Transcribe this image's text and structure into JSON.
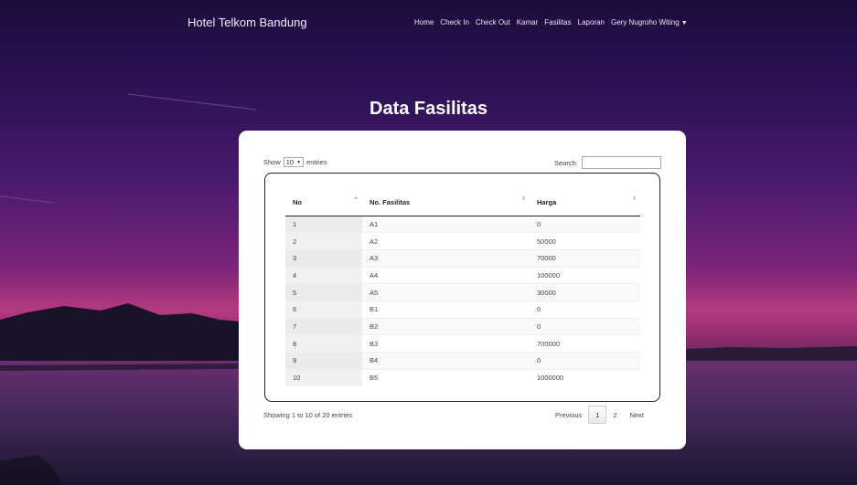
{
  "nav": {
    "brand": "Hotel Telkom Bandung",
    "links": [
      "Home",
      "Check In",
      "Check Out",
      "Kamar",
      "Fasilitas",
      "Laporan"
    ],
    "user": "Gery Nugroho Witing"
  },
  "page_title": "Data Fasilitas",
  "table_controls": {
    "show_label": "Show",
    "entries_value": "10",
    "entries_label": "entries",
    "search_label": "Search:",
    "search_value": ""
  },
  "table": {
    "headers": [
      "No",
      "No. Fasilitas",
      "Harga"
    ],
    "rows": [
      [
        "1",
        "A1",
        "0"
      ],
      [
        "2",
        "A2",
        "50000"
      ],
      [
        "3",
        "A3",
        "70000"
      ],
      [
        "4",
        "A4",
        "100000"
      ],
      [
        "5",
        "A5",
        "30000"
      ],
      [
        "6",
        "B1",
        "0"
      ],
      [
        "7",
        "B2",
        "0"
      ],
      [
        "8",
        "B3",
        "700000"
      ],
      [
        "9",
        "B4",
        "0"
      ],
      [
        "10",
        "B5",
        "1000000"
      ]
    ]
  },
  "footer": {
    "info": "Showing 1 to 10 of 20 entries",
    "prev_label": "Previous",
    "pages": [
      "1",
      "2"
    ],
    "next_label": "Next"
  },
  "icons": {
    "user_menu": "caret-down-icon",
    "entries_select": "caret-down-icon",
    "sort": "sort-arrows-icon"
  }
}
